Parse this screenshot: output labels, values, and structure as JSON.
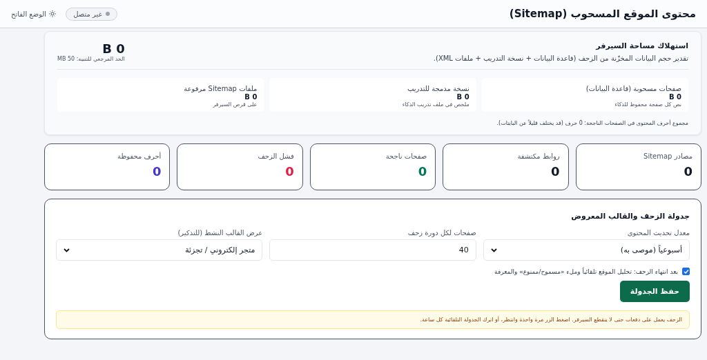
{
  "header": {
    "title": "محتوى الموقع المسحوب (Sitemap)",
    "status": {
      "label": "غير متصل",
      "online": false
    },
    "theme_button": "الوضع الفاتح"
  },
  "storage": {
    "title": "استهلاك مساحة السيرفر",
    "description": "تقدير حجم البيانات المخزّنة من الزحف (قاعدة البيانات + نسخة التدريب + ملفات XML).",
    "total": "B 0",
    "limit": "الحد المرجعي للتنبيه: 50 MB",
    "items": [
      {
        "label": "صفحات مسحوبة (قاعدة البيانات)",
        "value": "B 0",
        "note": "نص كل صفحة محفوظ للذكاء"
      },
      {
        "label": "نسخة مدمجة للتدريب",
        "value": "B 0",
        "note": "ملخص في ملف تدريب الذكاء"
      },
      {
        "label": "ملفات Sitemap مرفوعة",
        "value": "B 0",
        "note": "على قرص السيرفر"
      }
    ],
    "footnote": "مجموع أحرف المحتوى في الصفحات الناجحة: 0 حرف (قد يختلف قليلاً عن البايتات)."
  },
  "stats": [
    {
      "label": "مصادر Sitemap",
      "value": "0",
      "color": "#111827"
    },
    {
      "label": "روابط مكتشفة",
      "value": "0",
      "color": "#111827"
    },
    {
      "label": "صفحات ناجحة",
      "value": "0",
      "color": "#047857"
    },
    {
      "label": "فشل الزحف",
      "value": "0",
      "color": "#e11d48"
    },
    {
      "label": "أحرف محفوظة",
      "value": "0",
      "color": "#4338ca"
    }
  ],
  "schedule": {
    "title": "جدولة الزحف والقالب المعروض",
    "fields": [
      {
        "kind": "select",
        "label": "معدل تحديث المحتوى",
        "value": "أسبوعياً (موصى به)"
      },
      {
        "kind": "input",
        "label": "صفحات لكل دورة زحف",
        "value": "40"
      },
      {
        "kind": "select",
        "label": "عرض القالب النشط (للتذكير)",
        "value": "متجر إلكتروني / تجزئة"
      }
    ],
    "auto_analyze": {
      "label": "بعد انتهاء الزحف: تحليل الموقع تلقائياً وملء «مسموح/ممنوع» والمعرفة",
      "checked": true
    },
    "save_button": "حفظ الجدولة",
    "notice": "الزحف يعمل على دفعات حتى لا ينقطع السيرفر. اضغط الزر مرة واحدة وانتظر، أو اترك الجدولة التلقائية كل ساعة."
  }
}
